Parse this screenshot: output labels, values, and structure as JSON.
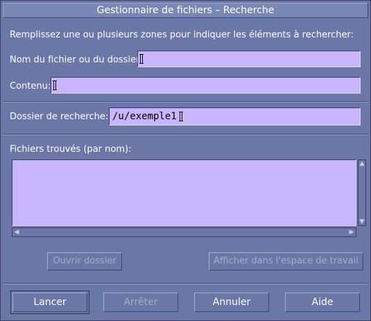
{
  "window": {
    "title": "Gestionnaire de fichiers – Recherche"
  },
  "instructions": "Remplissez une ou plusieurs zones pour indiquer les éléments à rechercher:",
  "fields": {
    "name_label": "Nom du fichier ou du dossier:",
    "name_value": "",
    "content_label": "Contenu:",
    "content_value": "",
    "folder_label": "Dossier de recherche:",
    "folder_value": "/u/exemple1"
  },
  "results": {
    "label": "Fichiers trouvés (par nom):"
  },
  "actions": {
    "open_folder": "Ouvrir dossier",
    "show_workspace": "Afficher dans l'espace de travail"
  },
  "buttons": {
    "start": "Lancer",
    "stop": "Arrêter",
    "cancel": "Annuler",
    "help": "Aide"
  },
  "colors": {
    "background": "#6b77a6",
    "field": "#c8b4ff"
  }
}
